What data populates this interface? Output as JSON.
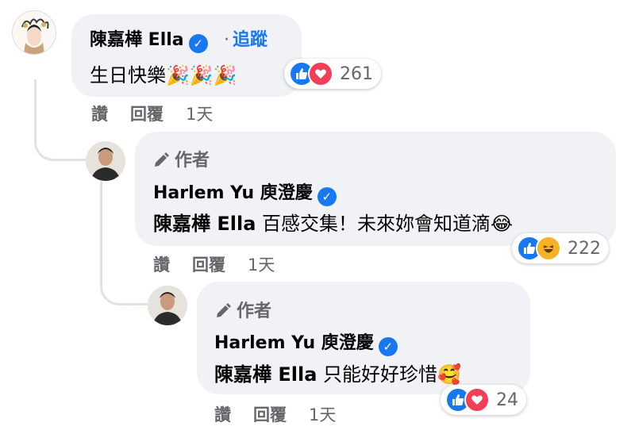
{
  "comment": {
    "name": "陳嘉樺 Ella",
    "follow_dot": "·",
    "follow": "追蹤",
    "text": "生日快樂🎉🎉🎉",
    "reactions": {
      "icons": [
        "like-icon",
        "love-icon"
      ],
      "count": "261"
    },
    "actions": {
      "like": "讚",
      "reply": "回覆",
      "time": "1天"
    }
  },
  "reply1": {
    "author_badge": "作者",
    "name": "Harlem Yu 庾澄慶",
    "mention": "陳嘉樺 Ella",
    "text": " 百感交集！未來妳會知道滴😂",
    "reactions": {
      "icons": [
        "like-icon",
        "haha-icon"
      ],
      "count": "222"
    },
    "actions": {
      "like": "讚",
      "reply": "回覆",
      "time": "1天"
    }
  },
  "reply2": {
    "author_badge": "作者",
    "name": "Harlem Yu 庾澄慶",
    "mention": "陳嘉樺 Ella",
    "text": " 只能好好珍惜🥰",
    "reactions": {
      "icons": [
        "like-icon",
        "love-icon"
      ],
      "count": "24"
    },
    "actions": {
      "like": "讚",
      "reply": "回覆",
      "time": "1天"
    }
  },
  "colors": {
    "link": "#1877f2",
    "bubble": "#f0f2f5",
    "meta": "#65676b",
    "love": "#f33e58",
    "haha": "#f7b125"
  }
}
